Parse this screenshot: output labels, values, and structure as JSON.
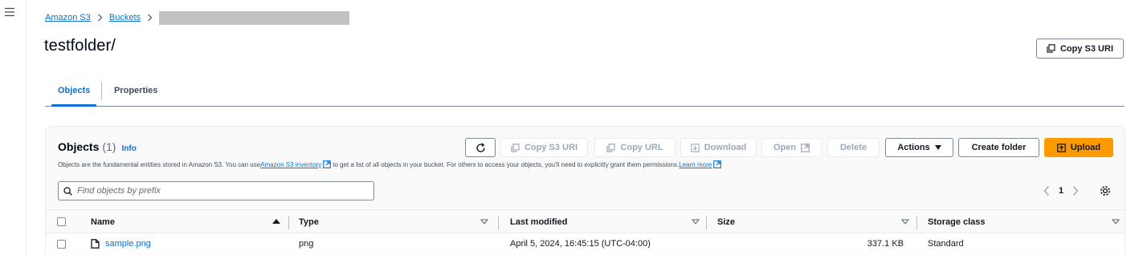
{
  "nav": {
    "menu_icon": "hamburger-icon"
  },
  "breadcrumb": {
    "items": [
      "Amazon S3",
      "Buckets"
    ],
    "separator_icon": "chevron-right-icon",
    "redacted": true
  },
  "page": {
    "title": "testfolder/",
    "copy_uri_label": "Copy S3 URI"
  },
  "tabs": [
    {
      "label": "Objects",
      "active": true
    },
    {
      "label": "Properties",
      "active": false
    }
  ],
  "objects_panel": {
    "title": "Objects",
    "count": "(1)",
    "info_label": "Info",
    "description_parts": [
      "Objects are the fundamental entities stored in Amazon S3. You can use ",
      "Amazon S3 inventory",
      " to get a list of all objects in your bucket. For others to access your objects, you'll need to explicitly grant them permissions. ",
      "Learn more"
    ],
    "toolbar": {
      "refresh_icon": "refresh-icon",
      "copy_s3_uri": "Copy S3 URI",
      "copy_url": "Copy URL",
      "download": "Download",
      "open": "Open",
      "delete": "Delete",
      "actions": "Actions",
      "create_folder": "Create folder",
      "upload": "Upload"
    },
    "search": {
      "placeholder": "Find objects by prefix",
      "value": ""
    },
    "pagination": {
      "current_page": "1"
    },
    "table": {
      "columns": [
        "Name",
        "Type",
        "Last modified",
        "Size",
        "Storage class"
      ],
      "rows": [
        {
          "name": "sample.png",
          "type": "png",
          "last_modified": "April 5, 2024, 16:45:15 (UTC-04:00)",
          "size": "337.1 KB",
          "storage_class": "Standard"
        }
      ]
    }
  },
  "colors": {
    "link": "#0972d3",
    "primary_button": "#ff9900",
    "text": "#16191f",
    "disabled_text": "#9ba7b6",
    "border": "#7d8998"
  }
}
